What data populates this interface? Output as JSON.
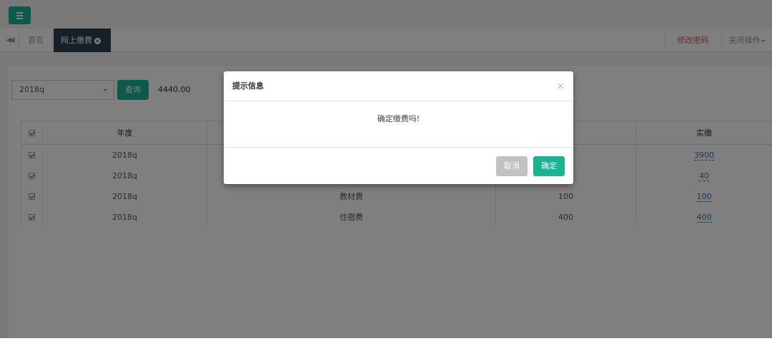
{
  "header": {
    "menu_icon": "hamburger-icon"
  },
  "tabs": {
    "back_icon": "double-left-arrow-icon",
    "home_label": "首页",
    "active_label": "网上缴费",
    "active_close_icon": "close-circle-icon",
    "change_password_label": "修改密码",
    "close_ops_label": "关闭操作"
  },
  "toolbar": {
    "year_select_value": "2018q",
    "query_label": "查询",
    "total_value": "4440.00"
  },
  "table": {
    "headers": [
      "",
      "年度",
      "",
      "",
      "实缴"
    ],
    "rows": [
      {
        "year": "2018q",
        "item": "",
        "due": "",
        "paid": "3900"
      },
      {
        "year": "2018q",
        "item": "",
        "due": "",
        "paid": "40"
      },
      {
        "year": "2018q",
        "item": "教材费",
        "due": "100",
        "paid": "100"
      },
      {
        "year": "2018q",
        "item": "住宿费",
        "due": "400",
        "paid": "400"
      }
    ]
  },
  "modal": {
    "title": "提示信息",
    "close_symbol": "×",
    "message": "确定缴费吗!",
    "cancel_label": "取消",
    "confirm_label": "确定"
  },
  "colors": {
    "accent": "#1ab394",
    "nav_dark": "#2f4050",
    "danger": "#d9534f"
  }
}
